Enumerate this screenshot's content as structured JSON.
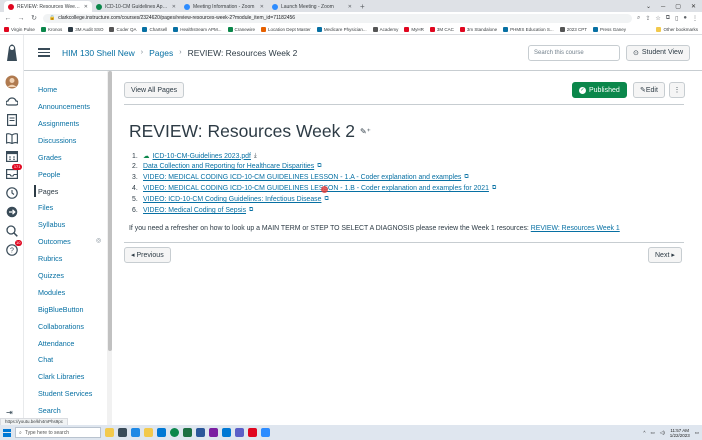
{
  "browser": {
    "tabs": [
      {
        "title": "REVIEW: Resources Week 2: HIM",
        "active": true,
        "color": "#e0061f"
      },
      {
        "title": "ICD-10-CM Guidelines April 1 20...",
        "active": false,
        "color": "#0b874b"
      },
      {
        "title": "Meeting Information - Zoom",
        "active": false,
        "color": "#2d8cff"
      },
      {
        "title": "Launch Meeting - Zoom",
        "active": false,
        "color": "#2d8cff"
      }
    ],
    "new_tab": "+",
    "url": "clarkcollege.instructure.com/courses/2324620/pages/review-resources-week-2?module_item_id=71182456",
    "bookmarks": [
      {
        "label": "Virgin Pulse",
        "color": "#e0061f"
      },
      {
        "label": "Kronos",
        "color": "#0b874b"
      },
      {
        "label": "3M Audit SSO",
        "color": "#2d3b45"
      },
      {
        "label": "Coder QA",
        "color": "#555555"
      },
      {
        "label": "Chartsell",
        "color": "#0770a3"
      },
      {
        "label": "Healthstream APM...",
        "color": "#0770a3"
      },
      {
        "label": "Cranewire",
        "color": "#0b874b"
      },
      {
        "label": "Location Dept Master",
        "color": "#e66000"
      },
      {
        "label": "Medicare Physician...",
        "color": "#0770a3"
      },
      {
        "label": "Academy",
        "color": "#555555"
      },
      {
        "label": "MyHR",
        "color": "#e0061f"
      },
      {
        "label": "3M CAC",
        "color": "#e0061f"
      },
      {
        "label": "3m Standalone",
        "color": "#e0061f"
      },
      {
        "label": "PHMIS Education S...",
        "color": "#0770a3"
      },
      {
        "label": "2023 CPT",
        "color": "#555555"
      },
      {
        "label": "Press Ganey",
        "color": "#0770a3"
      }
    ],
    "other_bookmarks": "Other bookmarks"
  },
  "global_nav": {
    "badges": {
      "inbox": "171",
      "history": "10"
    }
  },
  "header": {
    "breadcrumbs": [
      "HIM 130 Shell New",
      "Pages",
      "REVIEW: Resources Week 2"
    ],
    "search_placeholder": "Search this course",
    "student_view": "Student View"
  },
  "course_nav": {
    "items": [
      "Home",
      "Announcements",
      "Assignments",
      "Discussions",
      "Grades",
      "People",
      "Pages",
      "Files",
      "Syllabus",
      "Outcomes",
      "Rubrics",
      "Quizzes",
      "Modules",
      "BigBlueButton",
      "Collaborations",
      "Attendance",
      "Chat",
      "Clark Libraries",
      "Student Services",
      "Search"
    ],
    "active": "Pages"
  },
  "toolbar": {
    "view_all": "View All Pages",
    "published": "Published",
    "edit": "Edit",
    "more": "⋮"
  },
  "page": {
    "title": "REVIEW: Resources Week 2",
    "items": [
      {
        "num": "1.",
        "text": "ICD-10-CM-Guidelines 2023.pdf",
        "kind": "file"
      },
      {
        "num": "2.",
        "text": "Data Collection and Reporting for Healthcare Disparities",
        "kind": "external"
      },
      {
        "num": "3.",
        "text": "VIDEO: MEDICAL CODING ICD-10-CM GUIDELINES LESSON - 1.A - Coder explanation and examples",
        "kind": "external"
      },
      {
        "num": "4.",
        "text": "VIDEO: MEDICAL CODING ICD-10-CM GUIDELINES LESSON - 1.B - Coder explanation and examples for 2021",
        "kind": "external"
      },
      {
        "num": "5.",
        "text": "VIDEO: ICD-10-CM Coding Guidelines: Infectious Disease",
        "kind": "external"
      },
      {
        "num": "6.",
        "text": "VIDEO: Medical Coding of Sepsis",
        "kind": "external"
      }
    ],
    "paragraph": "If you need a refresher on how to look up a MAIN TERM or STEP TO SELECT A DIAGNOSIS please review the Week 1 resources: ",
    "paragraph_link": "REVIEW: Resources Week 1",
    "previous": "◂ Previous",
    "next": "Next ▸"
  },
  "status_url": "https://youtu.be/kh4mPhs9pc",
  "taskbar": {
    "search_placeholder": "Type here to search",
    "time": "11:57 AM",
    "date": "1/22/2023"
  }
}
